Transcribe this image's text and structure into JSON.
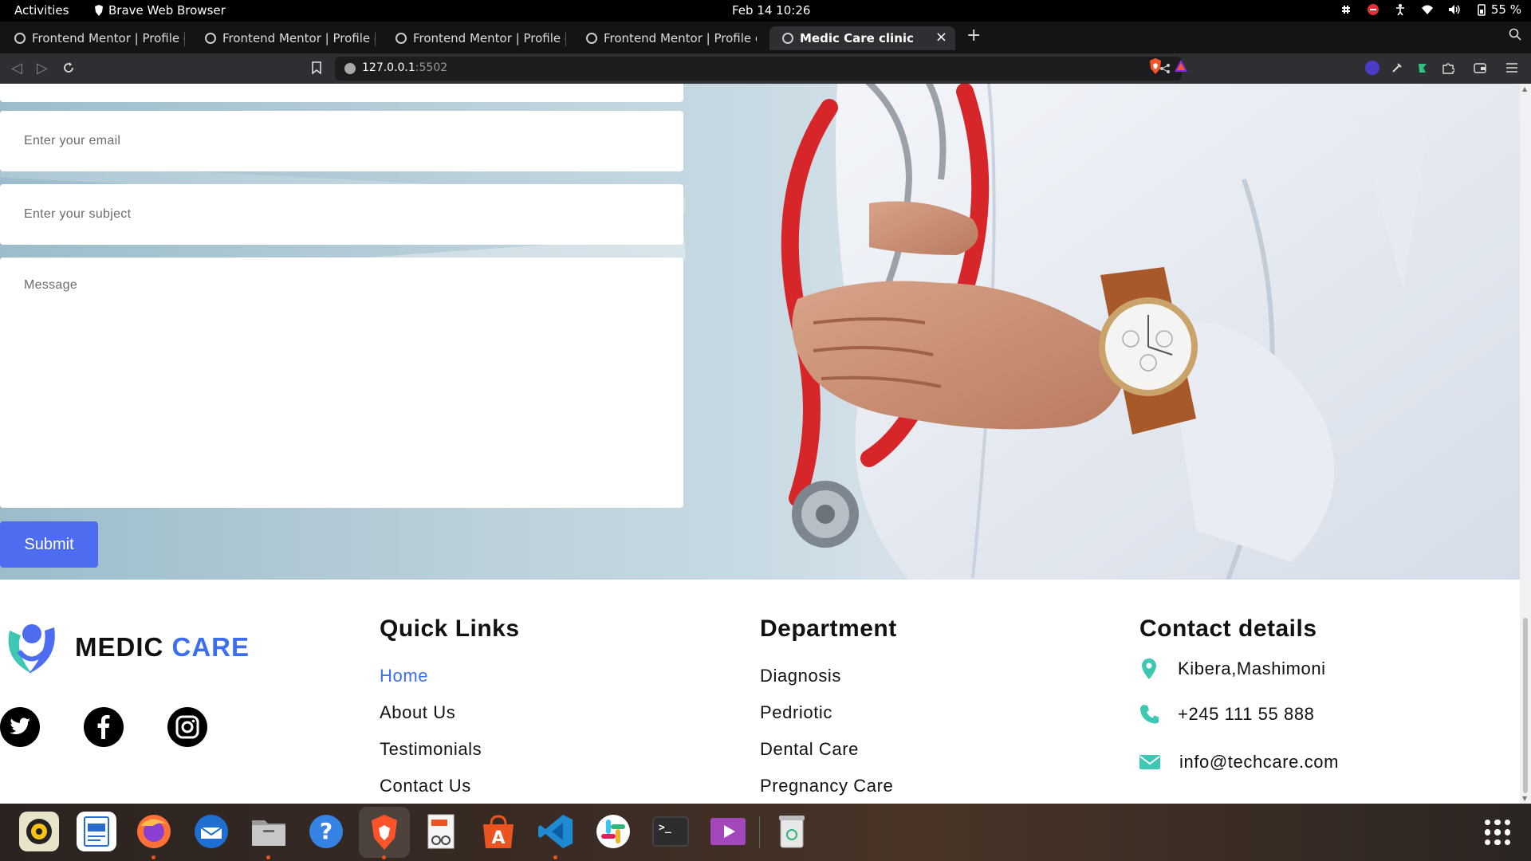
{
  "system_bar": {
    "activities": "Activities",
    "app_name": "Brave Web Browser",
    "datetime": "Feb 14  10:26",
    "battery": "55 %"
  },
  "tabs": [
    {
      "title": "Frontend Mentor | Profile ca",
      "active": false
    },
    {
      "title": "Frontend Mentor | Profile ca",
      "active": false
    },
    {
      "title": "Frontend Mentor | Profile ca",
      "active": false
    },
    {
      "title": "Frontend Mentor | Profile ca",
      "active": false
    },
    {
      "title": "Medic Care clinic",
      "active": true
    }
  ],
  "address_bar": {
    "host": "127.0.0.1",
    "port": ":5502"
  },
  "form": {
    "email_placeholder": "Enter your email",
    "subject_placeholder": "Enter your subject",
    "message_placeholder": "Message",
    "submit_label": "Submit"
  },
  "footer": {
    "brand": {
      "part1": "MEDIC",
      "part2": "CARE"
    },
    "quick_links": {
      "title": "Quick Links",
      "items": [
        "Home",
        "About Us",
        "Testimonials",
        "Contact Us"
      ]
    },
    "department": {
      "title": "Department",
      "items": [
        "Diagnosis",
        "Pedriotic",
        "Dental Care",
        "Pregnancy Care"
      ]
    },
    "contact": {
      "title": "Contact details",
      "location": "Kibera,Mashimoni",
      "phone": "+245 111 55 888",
      "email": "info@techcare.com"
    }
  },
  "colors": {
    "accent": "#3b6ef0",
    "submit": "#4d6cf0",
    "teal": "#3ec8b4"
  }
}
